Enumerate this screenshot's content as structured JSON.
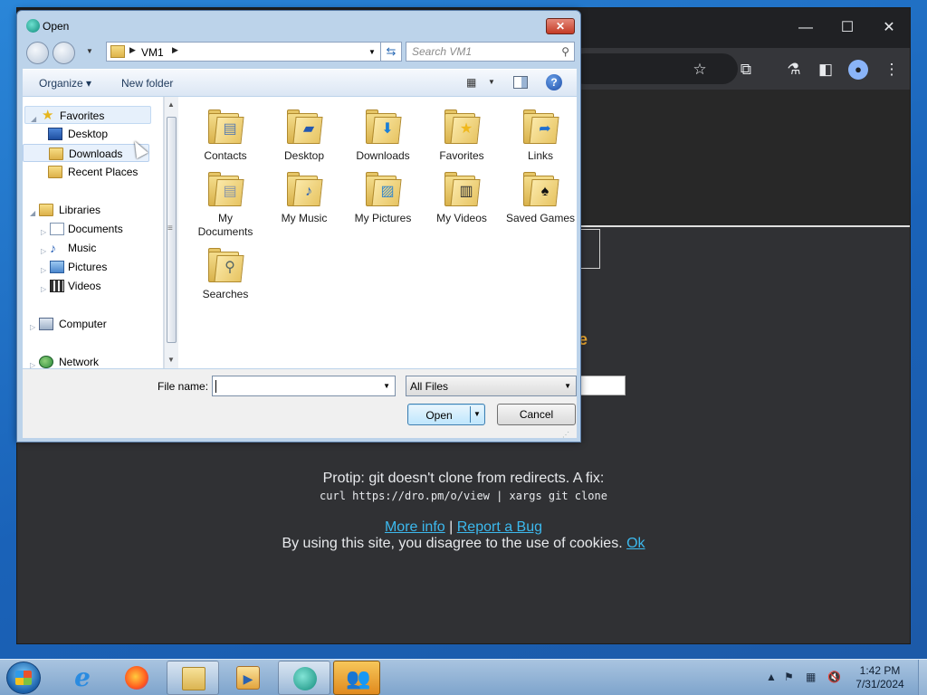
{
  "dialog": {
    "title": "Open",
    "close_glyph": "✕",
    "address": {
      "path": "VM1"
    },
    "search": {
      "placeholder": "Search VM1"
    },
    "toolbar": {
      "organize": "Organize",
      "new_folder": "New folder"
    },
    "nav_tree": [
      {
        "label": "Favorites",
        "icon": "star-icon",
        "state": "header"
      },
      {
        "label": "Desktop",
        "icon": "desktop-icon",
        "state": "hover"
      },
      {
        "label": "Downloads",
        "icon": "downloads-icon",
        "state": "selected"
      },
      {
        "label": "Recent Places",
        "icon": "recent-places-icon",
        "state": "normal"
      },
      {
        "label": "Libraries",
        "icon": "libraries-icon",
        "state": "header"
      },
      {
        "label": "Documents",
        "icon": "documents-icon",
        "state": "normal"
      },
      {
        "label": "Music",
        "icon": "music-icon",
        "state": "normal"
      },
      {
        "label": "Pictures",
        "icon": "pictures-icon",
        "state": "normal"
      },
      {
        "label": "Videos",
        "icon": "videos-icon",
        "state": "normal"
      },
      {
        "label": "Computer",
        "icon": "computer-icon",
        "state": "header"
      },
      {
        "label": "Network",
        "icon": "network-icon",
        "state": "header"
      }
    ],
    "files": [
      {
        "label": "Contacts",
        "icon": "contacts-folder-icon"
      },
      {
        "label": "Desktop",
        "icon": "desktop-folder-icon"
      },
      {
        "label": "Downloads",
        "icon": "downloads-folder-icon"
      },
      {
        "label": "Favorites",
        "icon": "favorites-folder-icon"
      },
      {
        "label": "Links",
        "icon": "links-folder-icon"
      },
      {
        "label": "My Documents",
        "icon": "documents-folder-icon"
      },
      {
        "label": "My Music",
        "icon": "music-folder-icon"
      },
      {
        "label": "My Pictures",
        "icon": "pictures-folder-icon"
      },
      {
        "label": "My Videos",
        "icon": "videos-folder-icon"
      },
      {
        "label": "Saved Games",
        "icon": "saved-games-folder-icon"
      },
      {
        "label": "Searches",
        "icon": "searches-folder-icon"
      }
    ],
    "filename": {
      "label": "File name:",
      "value": ""
    },
    "filetype": {
      "selected": "All Files"
    },
    "buttons": {
      "open": "Open",
      "cancel": "Cancel"
    }
  },
  "browser": {
    "protip": "Protip: git doesn't clone from redirects. A fix:",
    "protip_code": "curl https://dro.pm/o/view | xargs git clone",
    "more_info": "More info",
    "separator": "|",
    "report_bug": "Report a Bug",
    "cookie_text": "By using this site, you disagree to the use of cookies.",
    "cookie_ok": "Ok",
    "accent_color": "#3cb9ee"
  },
  "taskbar": {
    "apps": [
      {
        "name": "internet-explorer",
        "glyph": "e"
      },
      {
        "name": "firefox",
        "glyph": ""
      },
      {
        "name": "windows-explorer",
        "glyph": ""
      },
      {
        "name": "media-player",
        "glyph": "▶"
      },
      {
        "name": "active-app",
        "glyph": ""
      },
      {
        "name": "people-app",
        "glyph": "👥"
      }
    ],
    "time": "1:42 PM",
    "date": "7/31/2024"
  }
}
